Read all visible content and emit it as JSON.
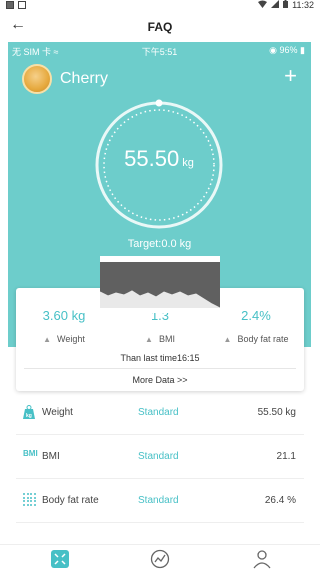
{
  "system_status": {
    "time": "11:32"
  },
  "toolbar": {
    "back_icon": "arrow-left-icon",
    "title": "FAQ"
  },
  "phone_status": {
    "carrier": "无 SIM 卡",
    "time": "下午5:51",
    "battery": "96%"
  },
  "profile": {
    "name": "Cherry",
    "add_icon": "plus-icon"
  },
  "gauge": {
    "value": "55.50",
    "unit": "kg",
    "target": "Target:0.0 kg"
  },
  "stats": [
    {
      "value": "3.60 kg",
      "label": "Weight"
    },
    {
      "value": "1.3",
      "label": "BMI"
    },
    {
      "value": "2.4%",
      "label": "Body fat rate"
    }
  ],
  "card": {
    "since": "Than last time16:15",
    "more": "More Data >>"
  },
  "metrics": [
    {
      "icon": "weight-icon",
      "badge": "kg",
      "name": "Weight",
      "status": "Standard",
      "value": "55.50 kg"
    },
    {
      "icon": "bmi-icon",
      "badge": "BMI",
      "name": "BMI",
      "status": "Standard",
      "value": "21.1"
    },
    {
      "icon": "body-fat-icon",
      "badge": "",
      "name": "Body fat rate",
      "status": "Standard",
      "value": "26.4 %"
    }
  ],
  "colors": {
    "teal": "#6dcdcb",
    "accent": "#47c0c6"
  }
}
